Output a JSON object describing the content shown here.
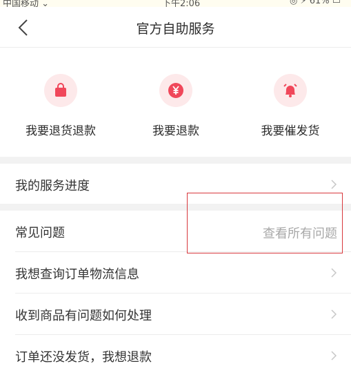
{
  "status_bar": {
    "carrier": "中国移动 ⌄",
    "time": "下午2:06",
    "battery": "◎ ⚡ 61% ▭"
  },
  "nav": {
    "title": "官方自助服务"
  },
  "quick_actions": [
    {
      "label": "我要退货退款",
      "icon": "shopping-bag-icon"
    },
    {
      "label": "我要退款",
      "icon": "yuan-coin-icon"
    },
    {
      "label": "我要催发货",
      "icon": "alarm-bell-icon"
    }
  ],
  "service_progress": {
    "label": "我的服务进度"
  },
  "faq": {
    "header": "常见问题",
    "view_all": "查看所有问题",
    "items": [
      {
        "label": "我想查询订单物流信息"
      },
      {
        "label": "收到商品有问题如何处理"
      },
      {
        "label": "订单还没发货，我想退款"
      }
    ]
  },
  "colors": {
    "accent": "#f0475a",
    "icon_bg": "#fde9ea",
    "highlight": "#d8373c",
    "divider": "#ececec",
    "section_gap": "#f2f2f2"
  }
}
